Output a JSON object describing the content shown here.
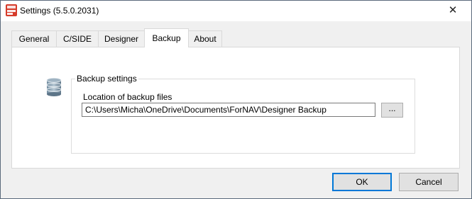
{
  "window": {
    "title": "Settings (5.5.0.2031)",
    "close_glyph": "✕"
  },
  "tabs": [
    {
      "label": "General",
      "active": false
    },
    {
      "label": "C/SIDE",
      "active": false
    },
    {
      "label": "Designer",
      "active": false
    },
    {
      "label": "Backup",
      "active": true
    },
    {
      "label": "About",
      "active": false
    }
  ],
  "backup": {
    "group_title": "Backup settings",
    "location_label": "Location of backup files",
    "location_value": "C:\\Users\\Micha\\OneDrive\\Documents\\ForNAV\\Designer Backup",
    "browse_label": "..."
  },
  "buttons": {
    "ok": "OK",
    "cancel": "Cancel"
  },
  "colors": {
    "accent": "#0078d7",
    "app_icon": "#d63b2a"
  },
  "icons": {
    "app": "fornav-app-icon",
    "database": "database-icon",
    "close": "close-icon"
  }
}
